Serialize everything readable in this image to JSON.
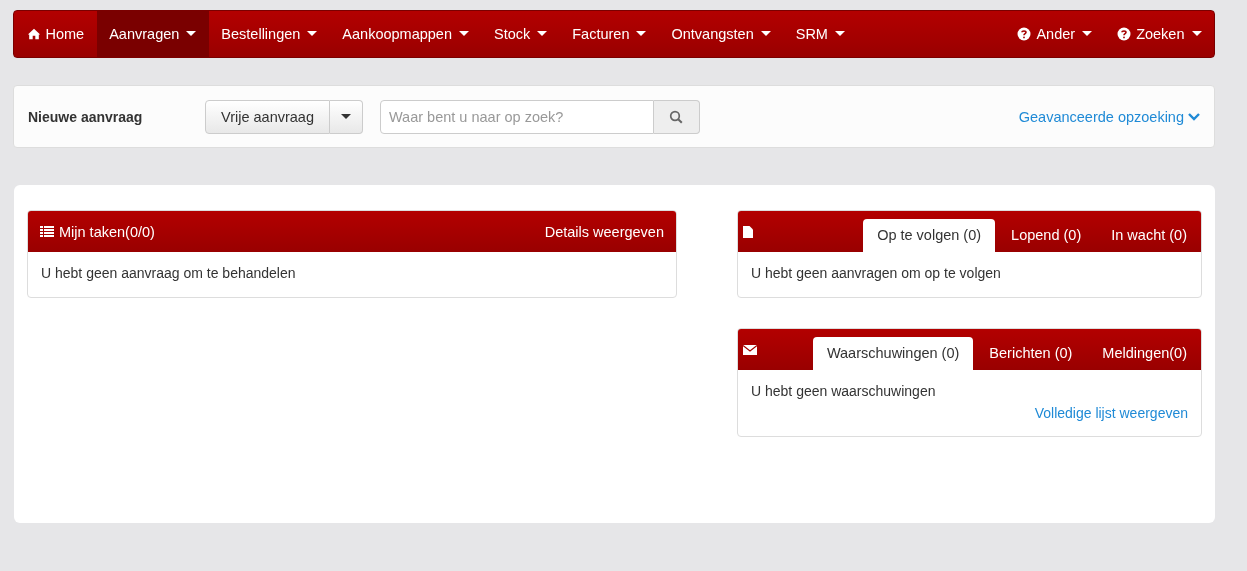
{
  "nav": {
    "items": [
      {
        "label": "Home",
        "kind": "home",
        "selected": false
      },
      {
        "label": "Aanvragen",
        "kind": "dropdown",
        "selected": true
      },
      {
        "label": "Bestellingen",
        "kind": "dropdown",
        "selected": false
      },
      {
        "label": "Aankoopmappen",
        "kind": "dropdown",
        "selected": false
      },
      {
        "label": "Stock",
        "kind": "dropdown",
        "selected": false
      },
      {
        "label": "Facturen",
        "kind": "dropdown",
        "selected": false
      },
      {
        "label": "Ontvangsten",
        "kind": "dropdown",
        "selected": false
      },
      {
        "label": "SRM",
        "kind": "dropdown",
        "selected": false
      }
    ],
    "right_items": [
      {
        "label": "Ander",
        "kind": "help",
        "selected": false
      },
      {
        "label": "Zoeken",
        "kind": "help",
        "selected": false
      }
    ]
  },
  "toolbar": {
    "title": "Nieuwe aanvraag",
    "split_button": "Vrije aanvraag",
    "search": {
      "placeholder": "Waar bent u naar op zoek?"
    },
    "advanced_link": "Geavanceerde opzoeking"
  },
  "tasks": {
    "title": "Mijn taken(0/0)",
    "action": "Details weergeven",
    "message": "U hebt geen aanvraag om te behandelen"
  },
  "follow": {
    "tabs": [
      {
        "label": "Op te volgen (0)",
        "selected": true
      },
      {
        "label": "Lopend (0)",
        "selected": false
      },
      {
        "label": "In wacht (0)",
        "selected": false
      }
    ],
    "message": "U hebt geen aanvragen om op te volgen"
  },
  "alerts": {
    "tabs": [
      {
        "label": "Waarschuwingen (0)",
        "selected": true
      },
      {
        "label": "Berichten (0)",
        "selected": false
      },
      {
        "label": "Meldingen(0)",
        "selected": false
      }
    ],
    "message": "U hebt geen waarschuwingen",
    "link": "Volledige lijst weergeven"
  }
}
